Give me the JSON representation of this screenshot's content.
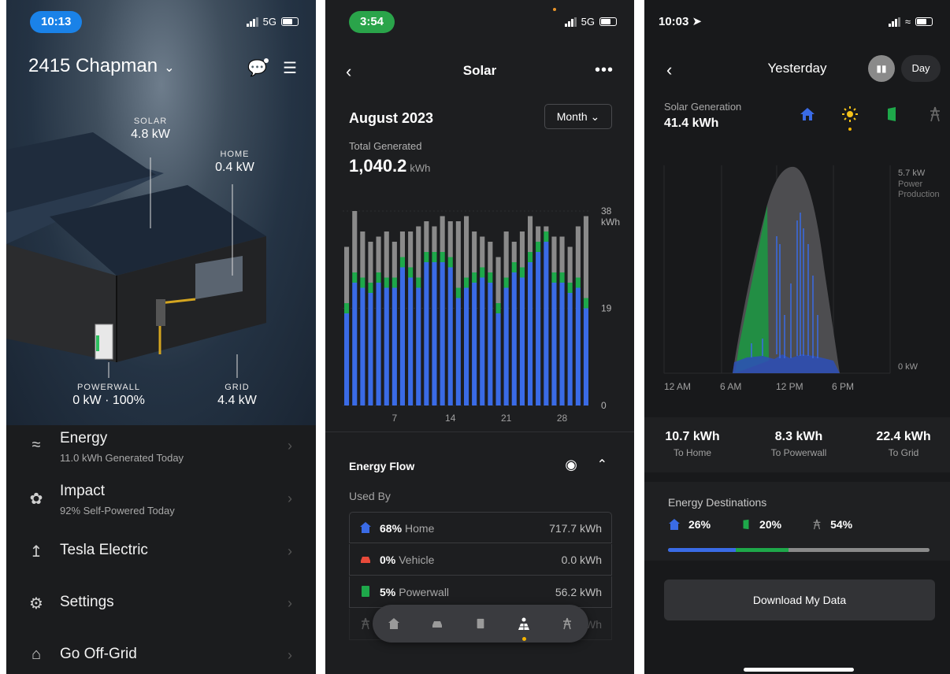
{
  "panel1": {
    "status": {
      "time": "10:13",
      "network": "5G"
    },
    "site_name": "2415 Chapman",
    "flows": {
      "solar": {
        "label": "SOLAR",
        "value": "4.8 kW"
      },
      "home": {
        "label": "HOME",
        "value": "0.4 kW"
      },
      "powerwall": {
        "label": "POWERWALL",
        "value": "0 kW · 100%"
      },
      "grid": {
        "label": "GRID",
        "value": "4.4 kW"
      }
    },
    "menu": [
      {
        "title": "Energy",
        "subtitle": "11.0 kWh Generated Today",
        "icon": "chart-line-icon"
      },
      {
        "title": "Impact",
        "subtitle": "92% Self-Powered Today",
        "icon": "leaf-icon"
      },
      {
        "title": "Tesla Electric",
        "subtitle": "",
        "icon": "tesla-electric-icon"
      },
      {
        "title": "Settings",
        "subtitle": "",
        "icon": "gear-icon"
      },
      {
        "title": "Go Off-Grid",
        "subtitle": "",
        "icon": "off-grid-icon"
      }
    ],
    "colors": {
      "status_pill": "#1a82e8"
    }
  },
  "panel2": {
    "status": {
      "time": "3:54",
      "network": "5G"
    },
    "title": "Solar",
    "period_title": "August 2023",
    "period_selector": "Month",
    "total_label": "Total Generated",
    "total_value": "1,040.2",
    "total_unit": "kWh",
    "chart_data": {
      "type": "bar",
      "stacked": true,
      "y_unit": "kWh",
      "ylim": [
        0,
        38
      ],
      "y_ticks": [
        "38",
        "19",
        "0"
      ],
      "x_ticks": [
        "7",
        "14",
        "21",
        "28"
      ],
      "categories": [
        "1",
        "2",
        "3",
        "4",
        "5",
        "6",
        "7",
        "8",
        "9",
        "10",
        "11",
        "12",
        "13",
        "14",
        "15",
        "16",
        "17",
        "18",
        "19",
        "20",
        "21",
        "22",
        "23",
        "24",
        "25",
        "26",
        "27",
        "28",
        "29",
        "30",
        "31"
      ],
      "series": [
        {
          "values": [
            18,
            24,
            23,
            22,
            24,
            23,
            23,
            27,
            25,
            23,
            28,
            28,
            28,
            27,
            21,
            23,
            24,
            25,
            24,
            18,
            23,
            26,
            25,
            28,
            30,
            32,
            24,
            24,
            22,
            23,
            19
          ]
        },
        {
          "values": [
            2,
            2,
            2,
            2,
            2,
            2,
            2,
            2,
            2,
            2,
            2,
            2,
            2,
            2,
            2,
            2,
            2,
            2,
            2,
            2,
            2,
            2,
            2,
            2,
            2,
            2,
            2,
            2,
            2,
            2,
            2
          ]
        },
        {
          "values": [
            11,
            12,
            9,
            8,
            7,
            9,
            7,
            5,
            7,
            10,
            6,
            5,
            7,
            7,
            13,
            12,
            8,
            6,
            6,
            9,
            9,
            4,
            7,
            7,
            3,
            1,
            7,
            7,
            7,
            10,
            16
          ]
        }
      ],
      "colors": [
        "#3a6be6",
        "#1ea84a",
        "#8a8a8a"
      ]
    },
    "energy_flow": {
      "title": "Energy Flow",
      "used_by_label": "Used By",
      "rows": [
        {
          "pct": "68%",
          "name": "Home",
          "kwh": "717.7 kWh",
          "icon": "home-icon",
          "color": "#3a6be6"
        },
        {
          "pct": "0%",
          "name": "Vehicle",
          "kwh": "0.0 kWh",
          "icon": "car-icon",
          "color": "#e84a3a"
        },
        {
          "pct": "5%",
          "name": "Powerwall",
          "kwh": "56.2 kWh",
          "icon": "powerwall-icon",
          "color": "#1ea84a"
        },
        {
          "pct": "",
          "name": "",
          "kwh": "Wh",
          "icon": "grid-tower-icon",
          "color": "#8a8a8a"
        }
      ]
    },
    "tabbar": [
      "home-icon",
      "car-icon",
      "powerwall-icon",
      "solar-icon",
      "grid-tower-icon"
    ],
    "colors": {
      "status_pill": "#2aa44a"
    }
  },
  "panel3": {
    "status": {
      "time": "10:03"
    },
    "title": "Yesterday",
    "period_button": "Day",
    "gen_label": "Solar Generation",
    "gen_value": "41.4 kWh",
    "chart_data": {
      "type": "area",
      "x_ticks": [
        "12 AM",
        "6 AM",
        "12 PM",
        "6 PM"
      ],
      "y_top_label": "5.7 kW",
      "y_top_sublabel": [
        "Power",
        "Production"
      ],
      "y_bottom_label": "0 kW",
      "ylim": [
        0,
        5.7
      ],
      "series_colors": {
        "solar": "#4d4d50",
        "powerwall": "#1ea84a",
        "home": "#3a6be6"
      }
    },
    "stats": [
      {
        "value": "10.7 kWh",
        "label": "To Home"
      },
      {
        "value": "8.3 kWh",
        "label": "To Powerwall"
      },
      {
        "value": "22.4 kWh",
        "label": "To Grid"
      }
    ],
    "destinations": {
      "title": "Energy Destinations",
      "items": [
        {
          "pct": "26%",
          "icon": "home-icon",
          "color": "#3a6be6"
        },
        {
          "pct": "20%",
          "icon": "powerwall-icon",
          "color": "#1ea84a"
        },
        {
          "pct": "54%",
          "icon": "grid-tower-icon",
          "color": "#8a8a8a"
        }
      ]
    },
    "download_label": "Download My Data"
  }
}
